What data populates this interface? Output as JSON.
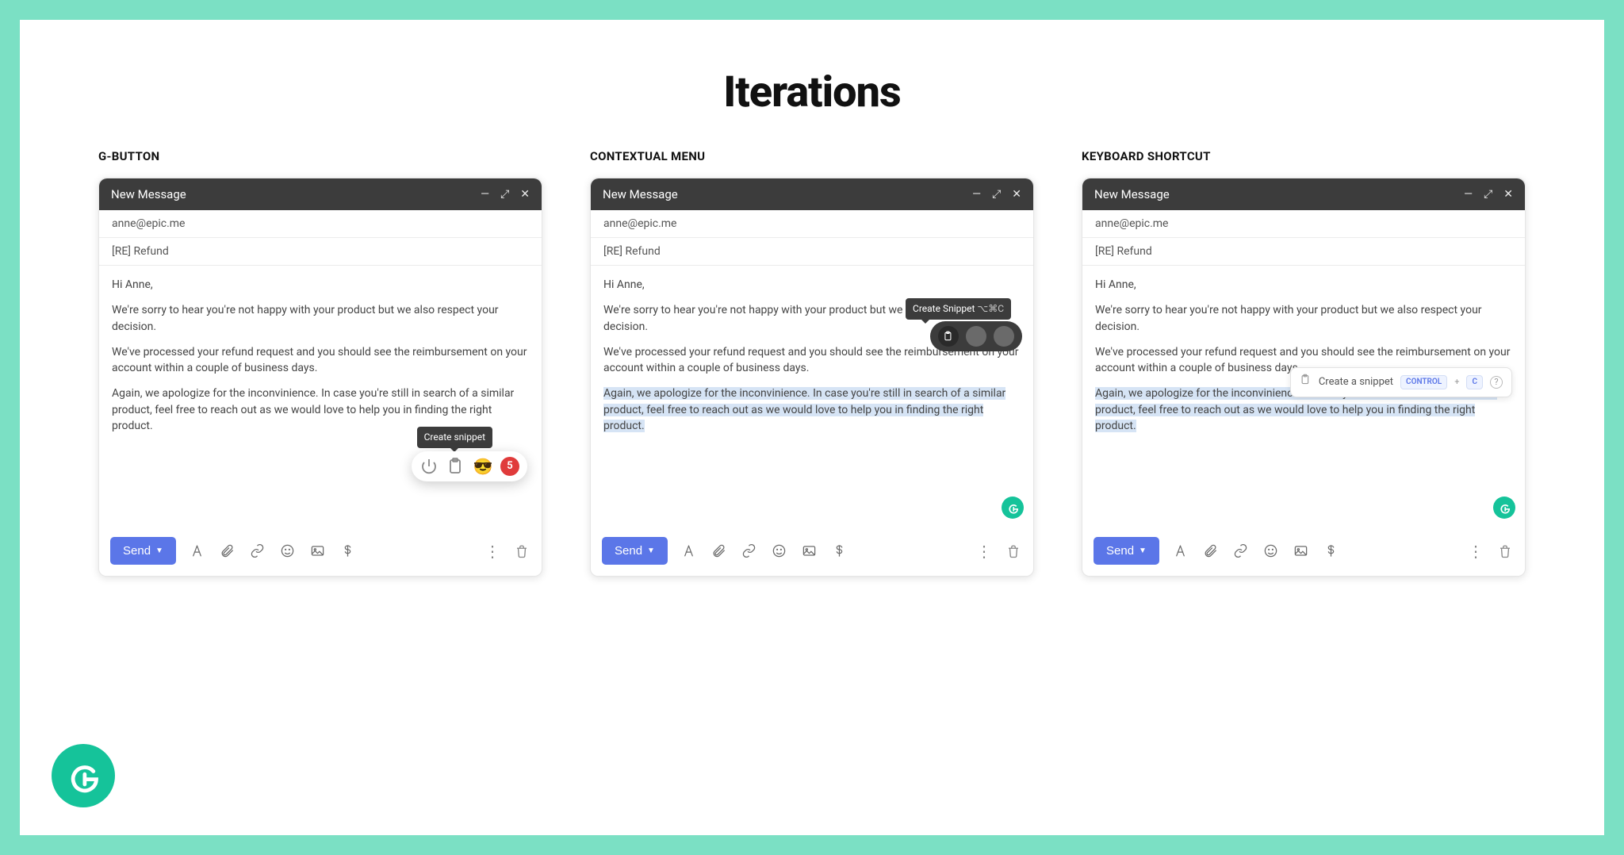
{
  "pageTitle": "Iterations",
  "columns": [
    {
      "label": "G-BUTTON"
    },
    {
      "label": "CONTEXTUAL MENU"
    },
    {
      "label": "KEYBOARD SHORTCUT"
    }
  ],
  "compose": {
    "windowTitle": "New Message",
    "to": "anne@epic.me",
    "subject": "[RE] Refund",
    "greeting": "Hi Anne,",
    "p1": "We're sorry to hear you're not happy with your product but we also respect your decision.",
    "p2": "We've processed your refund request and you should see the reimbursement on your account within a couple of business days.",
    "p3": "Again, we apologize for the inconvinience. In case you're still in  search of a similar product, feel free to reach out as we would love to help you in finding the right product.",
    "sendLabel": "Send"
  },
  "iter1": {
    "tooltip": "Create snippet",
    "badgeCount": "5"
  },
  "iter2": {
    "tooltip": "Create Snippet",
    "shortcut": "⌥⌘C"
  },
  "iter3": {
    "hintLabel": "Create a snippet",
    "key1": "CONTROL",
    "keyPlus": "+",
    "key2": "C"
  }
}
